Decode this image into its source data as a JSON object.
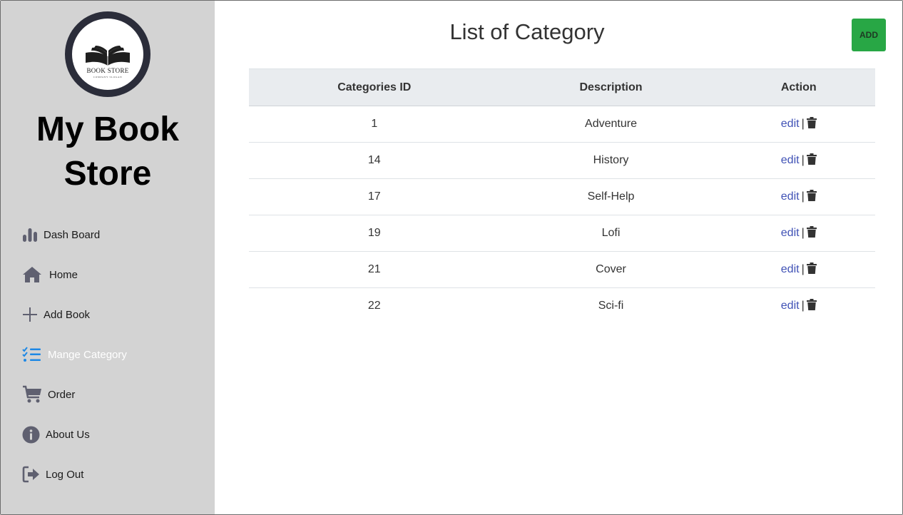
{
  "sidebar": {
    "logo": {
      "title": "BOOK STORE",
      "subtitle": "COMPANY SLOGAN"
    },
    "brand_line1": "My Book",
    "brand_line2": "Store",
    "items": [
      {
        "label": "Dash Board",
        "icon": "bar-chart-icon",
        "active": false
      },
      {
        "label": "Home",
        "icon": "home-icon",
        "active": false
      },
      {
        "label": "Add Book",
        "icon": "plus-icon",
        "active": false
      },
      {
        "label": "Mange Category",
        "icon": "task-list-icon",
        "active": true
      },
      {
        "label": "Order",
        "icon": "cart-icon",
        "active": false
      },
      {
        "label": "About Us",
        "icon": "info-icon",
        "active": false
      },
      {
        "label": "Log Out",
        "icon": "logout-icon",
        "active": false
      }
    ]
  },
  "main": {
    "title": "List of Category",
    "add_label": "ADD",
    "table": {
      "headers": [
        "Categories ID",
        "Description",
        "Action"
      ],
      "rows": [
        {
          "id": "1",
          "description": "Adventure",
          "edit": "edit",
          "sep": "|"
        },
        {
          "id": "14",
          "description": "History",
          "edit": "edit",
          "sep": "|"
        },
        {
          "id": "17",
          "description": "Self-Help",
          "edit": "edit",
          "sep": "|"
        },
        {
          "id": "19",
          "description": "Lofi",
          "edit": "edit",
          "sep": "|"
        },
        {
          "id": "21",
          "description": "Cover",
          "edit": "edit",
          "sep": "|"
        },
        {
          "id": "22",
          "description": "Sci-fi",
          "edit": "edit",
          "sep": "|"
        }
      ]
    }
  },
  "colors": {
    "sidebar_bg": "#d3d3d3",
    "accent_active": "#1e88e5",
    "add_button": "#28a745",
    "link": "#3f51b5",
    "icon_gray": "#5f6070"
  }
}
